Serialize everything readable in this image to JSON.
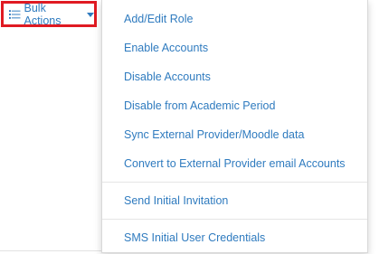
{
  "toolbar": {
    "bulk_actions_label": "Bulk Actions"
  },
  "icons": {
    "list": "list-icon",
    "caret": "caret-down-icon"
  },
  "colors": {
    "link": "#2f7bbf",
    "highlight_border": "#e01a22"
  },
  "menu": {
    "group1": [
      {
        "label": "Add/Edit Role"
      },
      {
        "label": "Enable Accounts"
      },
      {
        "label": "Disable Accounts"
      },
      {
        "label": "Disable from Academic Period"
      },
      {
        "label": "Sync External Provider/Moodle data"
      },
      {
        "label": "Convert to External Provider email Accounts"
      }
    ],
    "group2": [
      {
        "label": "Send Initial Invitation"
      }
    ],
    "group3": [
      {
        "label": "SMS Initial User Credentials"
      }
    ]
  }
}
